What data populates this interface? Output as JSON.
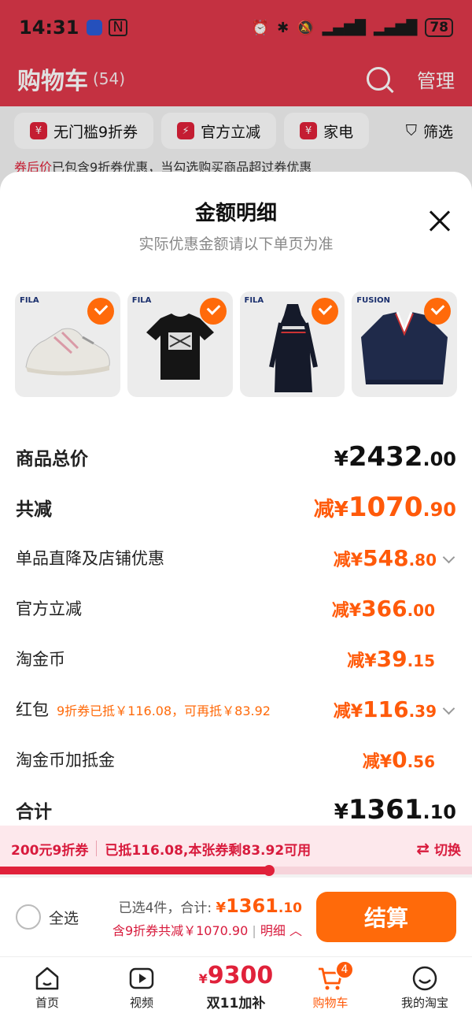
{
  "status_bar": {
    "time": "14:31",
    "nfc": "N",
    "battery": "78"
  },
  "cart_header": {
    "title": "购物车",
    "count": "(54)",
    "manage": "管理"
  },
  "filters": [
    {
      "icon": "¥",
      "label": "无门槛9折券"
    },
    {
      "icon": "⚡",
      "label": "官方立减"
    },
    {
      "icon": "¥",
      "label": "家电"
    }
  ],
  "filter_button": "筛选",
  "notice": {
    "red": "券后价",
    "text": "已包含9折券优惠，当勾选购买商品超过券优惠"
  },
  "sheet": {
    "title": "金额明细",
    "subtitle": "实际优惠金额请以下单页为准",
    "products": [
      {
        "brand": "FILA",
        "kind": "shoe-icon"
      },
      {
        "brand": "FILA",
        "kind": "tshirt-icon"
      },
      {
        "brand": "FILA",
        "kind": "dress-icon"
      },
      {
        "brand": "FUSION",
        "kind": "sweater-icon"
      }
    ],
    "rows": [
      {
        "label": "商品总价",
        "prefix": "¥",
        "int": "2432",
        "dec": ".00",
        "style": "big-black"
      },
      {
        "label": "共减",
        "prefix": "减¥",
        "int": "1070",
        "dec": ".90",
        "style": "big-orange"
      },
      {
        "label": "单品直降及店铺优惠",
        "prefix": "减¥",
        "int": "548",
        "dec": ".80",
        "style": "orange",
        "expand": true
      },
      {
        "label": "官方立减",
        "prefix": "减¥",
        "int": "366",
        "dec": ".00",
        "style": "orange"
      },
      {
        "label": "淘金币",
        "prefix": "减¥",
        "int": "39",
        "dec": ".15",
        "style": "orange"
      },
      {
        "label": "红包",
        "hint": "9折券已抵￥116.08，可再抵￥83.92",
        "prefix": "减¥",
        "int": "116",
        "dec": ".39",
        "style": "orange",
        "expand": true
      },
      {
        "label": "淘金币加抵金",
        "prefix": "减¥",
        "int": "0",
        "dec": ".56",
        "style": "orange"
      },
      {
        "label": "合计",
        "prefix": "¥",
        "int": "1361",
        "dec": ".10",
        "style": "big-black"
      }
    ]
  },
  "coupon": {
    "name": "200元9折券",
    "info": "已抵116.08,本张券剩83.92可用",
    "switch": "切换",
    "progress": 0.57
  },
  "checkout": {
    "select_all": "全选",
    "selected": "已选4件，",
    "total_label": "合计:",
    "total_prefix": "¥",
    "total_int": "1361",
    "total_dec": ".10",
    "discount_text": "含9折券共减￥1070.90",
    "detail": "明细",
    "settle": "结算"
  },
  "tabs": [
    {
      "label": "首页",
      "icon": "home-icon"
    },
    {
      "label": "视频",
      "icon": "video-icon"
    },
    {
      "label": "购物车",
      "icon": "cart-icon",
      "badge": "4",
      "active": true
    },
    {
      "label": "我的淘宝",
      "icon": "smile-icon"
    }
  ],
  "promo_tab": {
    "prefix": "¥",
    "amount": "9300",
    "label": "双11加补"
  },
  "colors": {
    "accent": "#ff5a0a",
    "brand_red": "#e0213a",
    "header_red": "#e0384a"
  }
}
